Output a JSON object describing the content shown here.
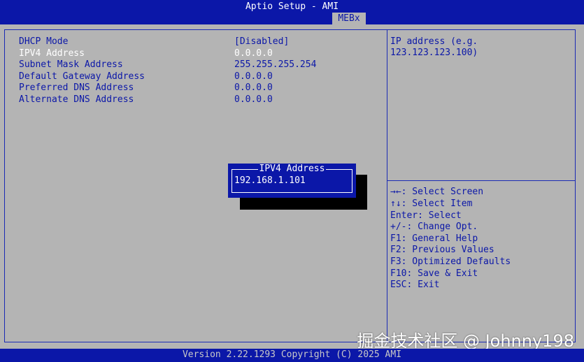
{
  "header": {
    "title": "Aptio Setup - AMI",
    "tab": "MEBx"
  },
  "settings": [
    {
      "label": "DHCP Mode",
      "value": "[Disabled]",
      "selected": false
    },
    {
      "label": "IPV4 Address",
      "value": "0.0.0.0",
      "selected": true
    },
    {
      "label": "Subnet Mask Address",
      "value": "255.255.255.254",
      "selected": false
    },
    {
      "label": "Default Gateway Address",
      "value": "0.0.0.0",
      "selected": false
    },
    {
      "label": "Preferred DNS Address",
      "value": "0.0.0.0",
      "selected": false
    },
    {
      "label": "Alternate DNS Address",
      "value": "0.0.0.0",
      "selected": false
    }
  ],
  "help": {
    "lines": [
      "IP address (e.g.",
      "123.123.123.100)"
    ]
  },
  "keys": [
    "→←: Select Screen",
    "↑↓: Select Item",
    "Enter: Select",
    "+/-: Change Opt.",
    "F1: General Help",
    "F2: Previous Values",
    "F3: Optimized Defaults",
    "F10: Save & Exit",
    "ESC: Exit"
  ],
  "popup": {
    "title": "IPV4 Address",
    "value": "192.168.1.101"
  },
  "footer": {
    "version": "Version 2.22.1293 Copyright (C) 2025 AMI"
  },
  "watermark": "掘金技术社区 @ Johnny198",
  "colors": {
    "bios_blue": "#0b17a8",
    "panel_gray": "#b4b4b4",
    "highlight_white": "#ffffff",
    "shadow_black": "#000000"
  }
}
